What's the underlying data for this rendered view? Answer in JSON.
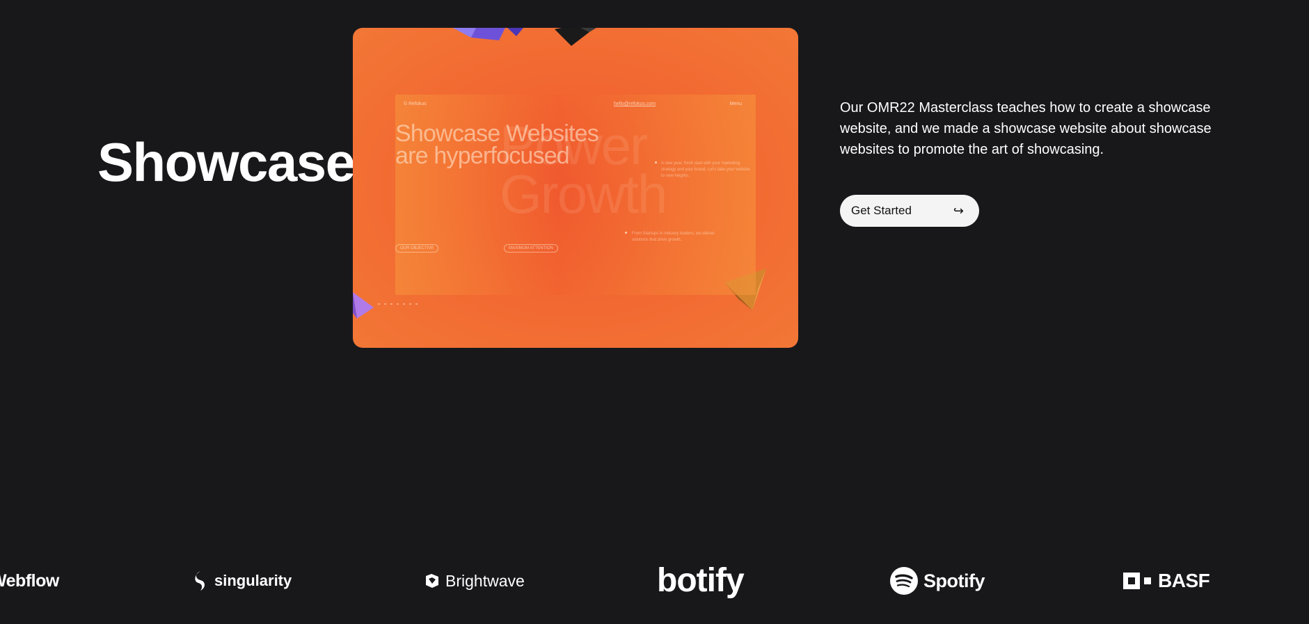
{
  "hero": {
    "title": "Showcase"
  },
  "preview": {
    "brand": "© Refokus",
    "link": "hello@refokus.com",
    "menu": "Menu",
    "headline_line1": "Showcase Websites",
    "headline_line2": "are hyperfocused",
    "ghost_line1": "Power",
    "ghost_line2": "Growth",
    "copy_a": "A new year, fresh start with your marketing strategy and your brand. Let's take your website to new heights.",
    "copy_b": "From Startups to industry leaders, we deliver solutions that drive growth.",
    "pill_left": "OUR OBJECTIVE",
    "pill_right": "MAXIMUM ATTENTION"
  },
  "description": "Our OMR22 Masterclass teaches how to create a showcase website, and we made a showcase website about showcase websites to promote the art of showcasing.",
  "cta": {
    "label": "Get Started",
    "icon": "↪"
  },
  "logos": [
    {
      "name": "Webflow",
      "icon": "webflow-logo"
    },
    {
      "name": "singularity",
      "icon": "singularity-logo"
    },
    {
      "name": "Brightwave",
      "icon": "brightwave-logo"
    },
    {
      "name": "botify",
      "icon": "botify-logo"
    },
    {
      "name": "Spotify",
      "icon": "spotify-logo"
    },
    {
      "name": "BASF",
      "icon": "basf-logo"
    }
  ],
  "colors": {
    "background": "#18181b",
    "accent": "#f26a32",
    "button": "#f4f4f5"
  }
}
